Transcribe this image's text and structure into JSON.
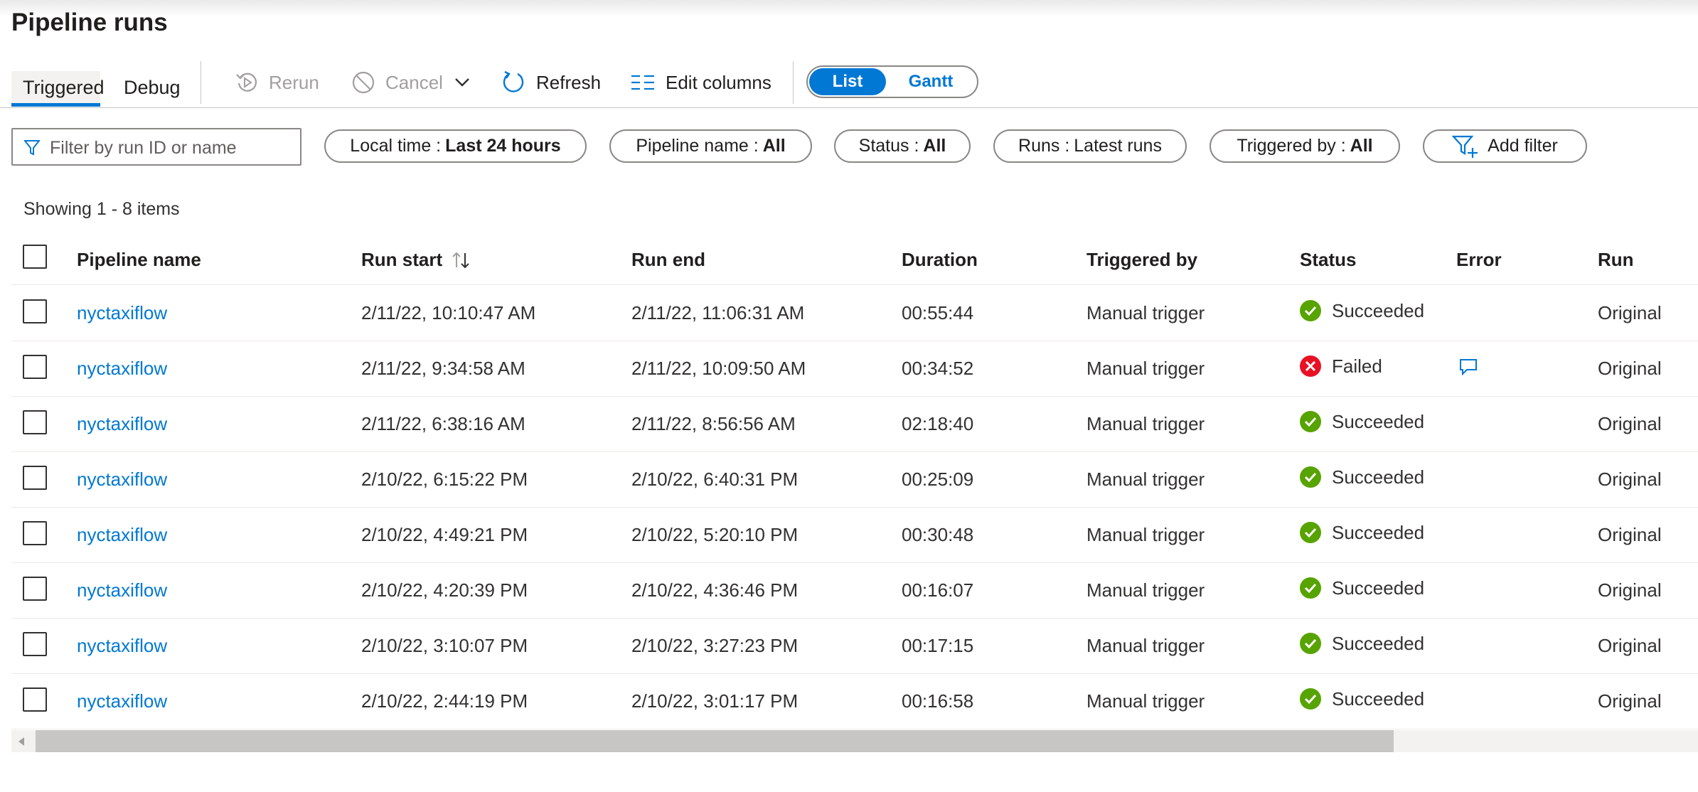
{
  "page": {
    "title": "Pipeline runs"
  },
  "tabs": [
    {
      "label": "Triggered",
      "active": true
    },
    {
      "label": "Debug",
      "active": false
    }
  ],
  "toolbar": {
    "rerun_label": "Rerun",
    "cancel_label": "Cancel",
    "refresh_label": "Refresh",
    "edit_columns_label": "Edit columns",
    "view_list_label": "List",
    "view_gantt_label": "Gantt"
  },
  "filters": {
    "search_placeholder": "Filter by run ID or name",
    "pills": [
      {
        "key": "Local time : ",
        "value": "Last 24 hours"
      },
      {
        "key": "Pipeline name : ",
        "value": "All"
      },
      {
        "key": "Status : ",
        "value": "All"
      },
      {
        "key": "Runs : ",
        "value": "Latest runs"
      },
      {
        "key": "Triggered by : ",
        "value": "All"
      }
    ],
    "add_filter_label": "Add filter"
  },
  "summary": {
    "showing": "Showing 1 - 8 items"
  },
  "table": {
    "columns": [
      "Pipeline name",
      "Run start",
      "Run end",
      "Duration",
      "Triggered by",
      "Status",
      "Error",
      "Run"
    ],
    "rows": [
      {
        "name": "nyctaxiflow",
        "start": "2/11/22, 10:10:47 AM",
        "end": "2/11/22, 11:06:31 AM",
        "duration": "00:55:44",
        "trigger": "Manual trigger",
        "status": "Succeeded",
        "run": "Original"
      },
      {
        "name": "nyctaxiflow",
        "start": "2/11/22, 9:34:58 AM",
        "end": "2/11/22, 10:09:50 AM",
        "duration": "00:34:52",
        "trigger": "Manual trigger",
        "status": "Failed",
        "run": "Original"
      },
      {
        "name": "nyctaxiflow",
        "start": "2/11/22, 6:38:16 AM",
        "end": "2/11/22, 8:56:56 AM",
        "duration": "02:18:40",
        "trigger": "Manual trigger",
        "status": "Succeeded",
        "run": "Original"
      },
      {
        "name": "nyctaxiflow",
        "start": "2/10/22, 6:15:22 PM",
        "end": "2/10/22, 6:40:31 PM",
        "duration": "00:25:09",
        "trigger": "Manual trigger",
        "status": "Succeeded",
        "run": "Original"
      },
      {
        "name": "nyctaxiflow",
        "start": "2/10/22, 4:49:21 PM",
        "end": "2/10/22, 5:20:10 PM",
        "duration": "00:30:48",
        "trigger": "Manual trigger",
        "status": "Succeeded",
        "run": "Original"
      },
      {
        "name": "nyctaxiflow",
        "start": "2/10/22, 4:20:39 PM",
        "end": "2/10/22, 4:36:46 PM",
        "duration": "00:16:07",
        "trigger": "Manual trigger",
        "status": "Succeeded",
        "run": "Original"
      },
      {
        "name": "nyctaxiflow",
        "start": "2/10/22, 3:10:07 PM",
        "end": "2/10/22, 3:27:23 PM",
        "duration": "00:17:15",
        "trigger": "Manual trigger",
        "status": "Succeeded",
        "run": "Original"
      },
      {
        "name": "nyctaxiflow",
        "start": "2/10/22, 2:44:19 PM",
        "end": "2/10/22, 3:01:17 PM",
        "duration": "00:16:58",
        "trigger": "Manual trigger",
        "status": "Succeeded",
        "run": "Original"
      }
    ]
  },
  "colors": {
    "accent": "#0078d4",
    "success": "#57a300",
    "failure": "#e81123"
  }
}
